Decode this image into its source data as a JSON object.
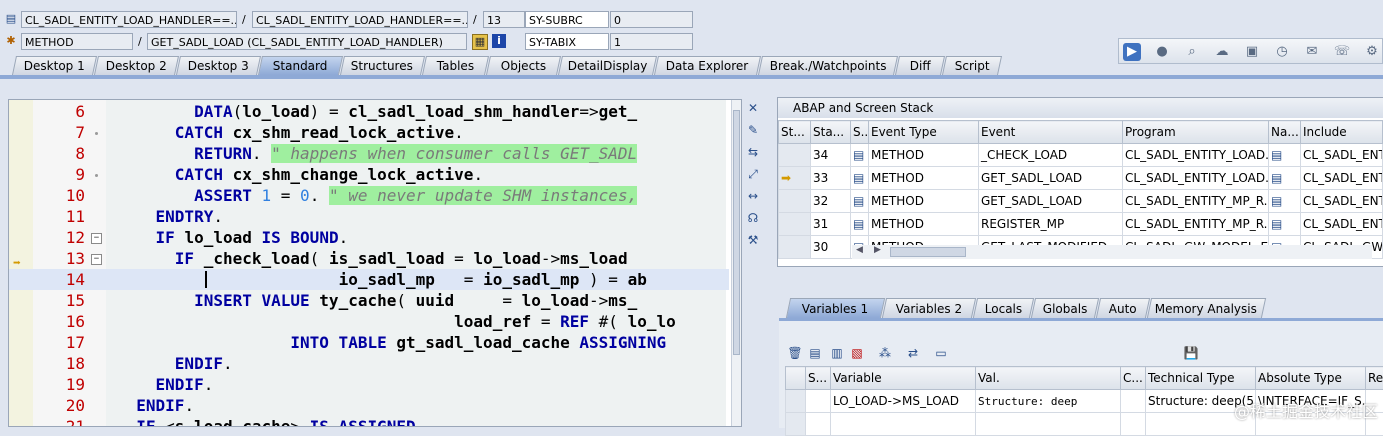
{
  "header": {
    "row1": {
      "program": "CL_SADL_ENTITY_LOAD_HANDLER==...",
      "include": "CL_SADL_ENTITY_LOAD_HANDLER==...",
      "line": "13",
      "sysvar_name": "SY-SUBRC",
      "sysvar_value": "0"
    },
    "row2": {
      "event_type": "METHOD",
      "event": "GET_SADL_LOAD (CL_SADL_ENTITY_LOAD_HANDLER)",
      "sysvar_name": "SY-TABIX",
      "sysvar_value": "1"
    },
    "sep": "/"
  },
  "tabs": [
    "Desktop 1",
    "Desktop 2",
    "Desktop 3",
    "Standard",
    "Structures",
    "Tables",
    "Objects",
    "DetailDisplay",
    "Data Explorer",
    "Break./Watchpoints",
    "Diff",
    "Script"
  ],
  "active_tab": "Standard",
  "code_lines": [
    {
      "n": "6",
      "html": "        <span class='kw'>DATA</span>(<span class='id'>lo_load</span>) = <span class='id'>cl_sadl_load_shm_handler</span>=&gt;<span class='id'>get_</span>"
    },
    {
      "n": "7",
      "html": "      <span class='kw'>CATCH</span> <span class='id'>cx_shm_read_lock_active</span>."
    },
    {
      "n": "8",
      "html": "        <span class='kw'>RETURN</span>. <span class='cmt'>\" happens when consumer calls GET_SADL</span>"
    },
    {
      "n": "9",
      "html": "      <span class='kw'>CATCH</span> <span class='id'>cx_shm_change_lock_active</span>."
    },
    {
      "n": "10",
      "html": "        <span class='kw'>ASSERT</span> <span class='num'>1</span> = <span class='num'>0</span>. <span class='cmt'>\" we never update SHM instances,</span>"
    },
    {
      "n": "11",
      "html": "    <span class='kw'>ENDTRY</span>."
    },
    {
      "n": "12",
      "html": "    <span class='kw'>IF</span> <span class='id'>lo_load</span> <span class='kw'>IS BOUND</span>."
    },
    {
      "n": "13",
      "html": "      <span class='kw'>IF</span> <span class='id'>_check_load</span>( <span class='id'>is_sadl_load</span> = <span class='id'>lo_load</span>-&gt;<span class='id'>ms_load</span>"
    },
    {
      "n": "14",
      "html": "                       <span class='id'>io_sadl_mp</span>   = <span class='id'>io_sadl_mp</span> ) = <span class='id'>ab</span>"
    },
    {
      "n": "15",
      "html": "        <span class='kw'>INSERT VALUE</span> <span class='id'>ty_cache</span>( <span class='id'>uuid</span>     = <span class='id'>lo_load</span>-&gt;<span class='id'>ms_</span>"
    },
    {
      "n": "16",
      "html": "                                   <span class='id'>load_ref</span> = <span class='kw'>REF</span> #( <span class='id'>lo_lo</span>"
    },
    {
      "n": "17",
      "html": "                  <span class='kw'>INTO TABLE</span> <span class='id'>gt_sadl_load_cache</span> <span class='kw'>ASSIGNING</span>"
    },
    {
      "n": "18",
      "html": "      <span class='kw'>ENDIF</span>."
    },
    {
      "n": "19",
      "html": "    <span class='kw'>ENDIF</span>."
    },
    {
      "n": "20",
      "html": "  <span class='kw'>ENDIF</span>."
    },
    {
      "n": "21",
      "html": "  <span class='kw'>IF</span> &lt;<span class='id'>s_load_cache</span>&gt; <span class='kw'>IS ASSIGNED</span>."
    }
  ],
  "stack": {
    "title": "ABAP and Screen Stack",
    "columns": [
      "St...",
      "Sta...",
      "S...",
      "Event Type",
      "Event",
      "Program",
      "Na...",
      "Include"
    ],
    "rows": [
      {
        "level": "34",
        "type": "METHOD",
        "event": "_CHECK_LOAD",
        "program": "CL_SADL_ENTITY_LOAD...",
        "include": "CL_SADL_ENT"
      },
      {
        "level": "33",
        "type": "METHOD",
        "event": "GET_SADL_LOAD",
        "program": "CL_SADL_ENTITY_LOAD...",
        "include": "CL_SADL_ENT",
        "current": true
      },
      {
        "level": "32",
        "type": "METHOD",
        "event": "GET_SADL_LOAD",
        "program": "CL_SADL_ENTITY_MP_R...",
        "include": "CL_SADL_ENT"
      },
      {
        "level": "31",
        "type": "METHOD",
        "event": "REGISTER_MP",
        "program": "CL_SADL_ENTITY_MP_R...",
        "include": "CL_SADL_ENT"
      },
      {
        "level": "30",
        "type": "METHOD",
        "event": "GET_LAST_MODIFIED",
        "program": "CL_SADL_GW_MODEL_E...",
        "include": "CL_SADL_GW_"
      }
    ]
  },
  "var_tabs": [
    "Variables 1",
    "Variables 2",
    "Locals",
    "Globals",
    "Auto",
    "Memory Analysis"
  ],
  "active_var_tab": "Variables 1",
  "variables": {
    "columns": [
      "S...",
      "Variable",
      "Val.",
      "C...",
      "Technical Type",
      "Absolute Type",
      "Re"
    ],
    "rows": [
      {
        "variable": "LO_LOAD->MS_LOAD",
        "value": "Structure: deep",
        "tech_type": "Structure: deep(5...",
        "abs_type": "\\INTERFACE=IF_S..."
      }
    ]
  },
  "watermark": "@稀土掘金技术社区",
  "colors": {
    "accent": "#3f72c0",
    "keyword": "#0000a0",
    "line_number": "#c00000",
    "comment_bg": "#9fef9f"
  }
}
